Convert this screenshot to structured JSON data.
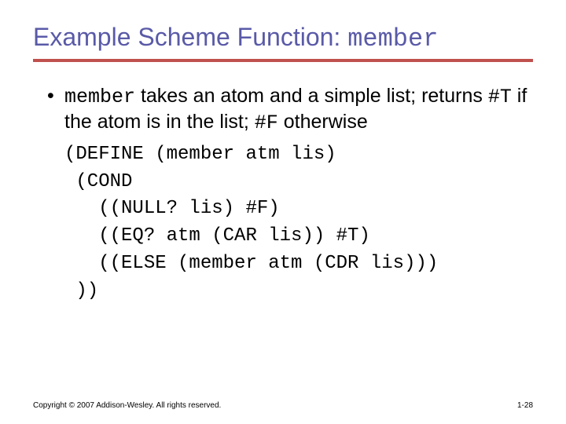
{
  "title": {
    "prefix": "Example Scheme Function: ",
    "code": "member"
  },
  "bullet": {
    "p1_code": "member",
    "p1_text": " takes an atom and a simple list; returns ",
    "p2_code": "#T",
    "p2_text": " if the atom is in the list; ",
    "p3_code": "#F",
    "p3_text": " otherwise"
  },
  "code": {
    "l1": "(DEFINE (member atm lis)",
    "l2": " (COND",
    "l3": "   ((NULL? lis) #F)",
    "l4": "   ((EQ? atm (CAR lis)) #T)",
    "l5": "   ((ELSE (member atm (CDR lis)))",
    "l6": " ))"
  },
  "footer": {
    "copyright": "Copyright © 2007 Addison-Wesley. All rights reserved.",
    "page": "1-28"
  }
}
